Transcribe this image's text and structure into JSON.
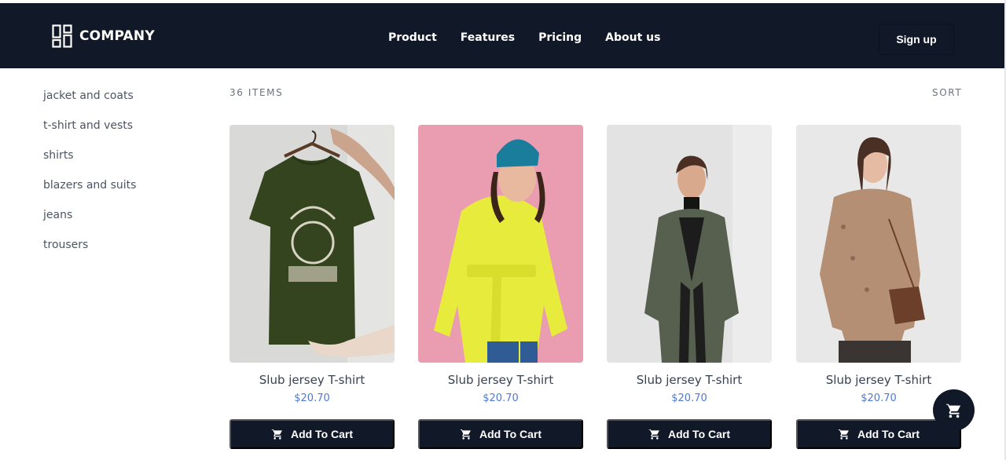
{
  "header": {
    "brand": "COMPANY",
    "logo_icon": "grid-logo-icon",
    "nav": [
      "Product",
      "Features",
      "Pricing",
      "About us"
    ],
    "signup": "Sign up"
  },
  "sidebar": {
    "categories": [
      "jacket and coats",
      "t-shirt and vests",
      "shirts",
      "blazers and suits",
      "jeans",
      "trousers"
    ]
  },
  "toolbar": {
    "items_count": "36 ITEMS",
    "sort": "SORT"
  },
  "products": [
    {
      "title": "Slub jersey T-shirt",
      "price": "$20.70",
      "button": "Add To Cart",
      "image": "green t-shirt on hanger"
    },
    {
      "title": "Slub jersey T-shirt",
      "price": "$20.70",
      "button": "Add To Cart",
      "image": "woman in yellow puffer jacket"
    },
    {
      "title": "Slub jersey T-shirt",
      "price": "$20.70",
      "button": "Add To Cart",
      "image": "woman in grey coat"
    },
    {
      "title": "Slub jersey T-shirt",
      "price": "$20.70",
      "button": "Add To Cart",
      "image": "woman in teddy jacket"
    }
  ],
  "cart_fab": {
    "icon": "cart-icon"
  },
  "colors": {
    "navbar": "#111827",
    "accent_price": "#4f78d1",
    "button": "#111827"
  }
}
